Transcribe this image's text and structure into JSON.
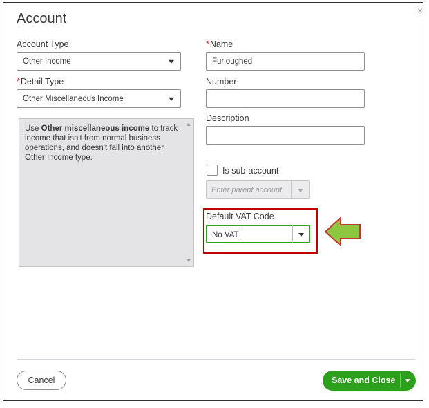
{
  "dialog": {
    "title": "Account",
    "close_glyph": "×"
  },
  "left": {
    "account_type_label": "Account Type",
    "account_type_value": "Other Income",
    "detail_type_label": "Detail Type",
    "detail_type_value": "Other Miscellaneous Income",
    "description_text_pre": "Use ",
    "description_text_bold": "Other miscellaneous income",
    "description_text_post": " to track income that isn't from normal business operations, and doesn't fall into another Other Income type."
  },
  "right": {
    "name_label": "Name",
    "name_value": "Furloughed",
    "number_label": "Number",
    "number_value": "",
    "description_label": "Description",
    "description_value": "",
    "subaccount_label": "Is sub-account",
    "subaccount_checked": false,
    "parent_placeholder": "Enter parent account",
    "vat_label": "Default VAT Code",
    "vat_value": "No VAT"
  },
  "required_mark": "*",
  "footer": {
    "cancel_label": "Cancel",
    "save_label": "Save and Close"
  },
  "colors": {
    "accent_green": "#2ca01c",
    "highlight_red": "#c00000",
    "arrow_fill": "#8dc63f",
    "arrow_stroke": "#c0392b"
  }
}
